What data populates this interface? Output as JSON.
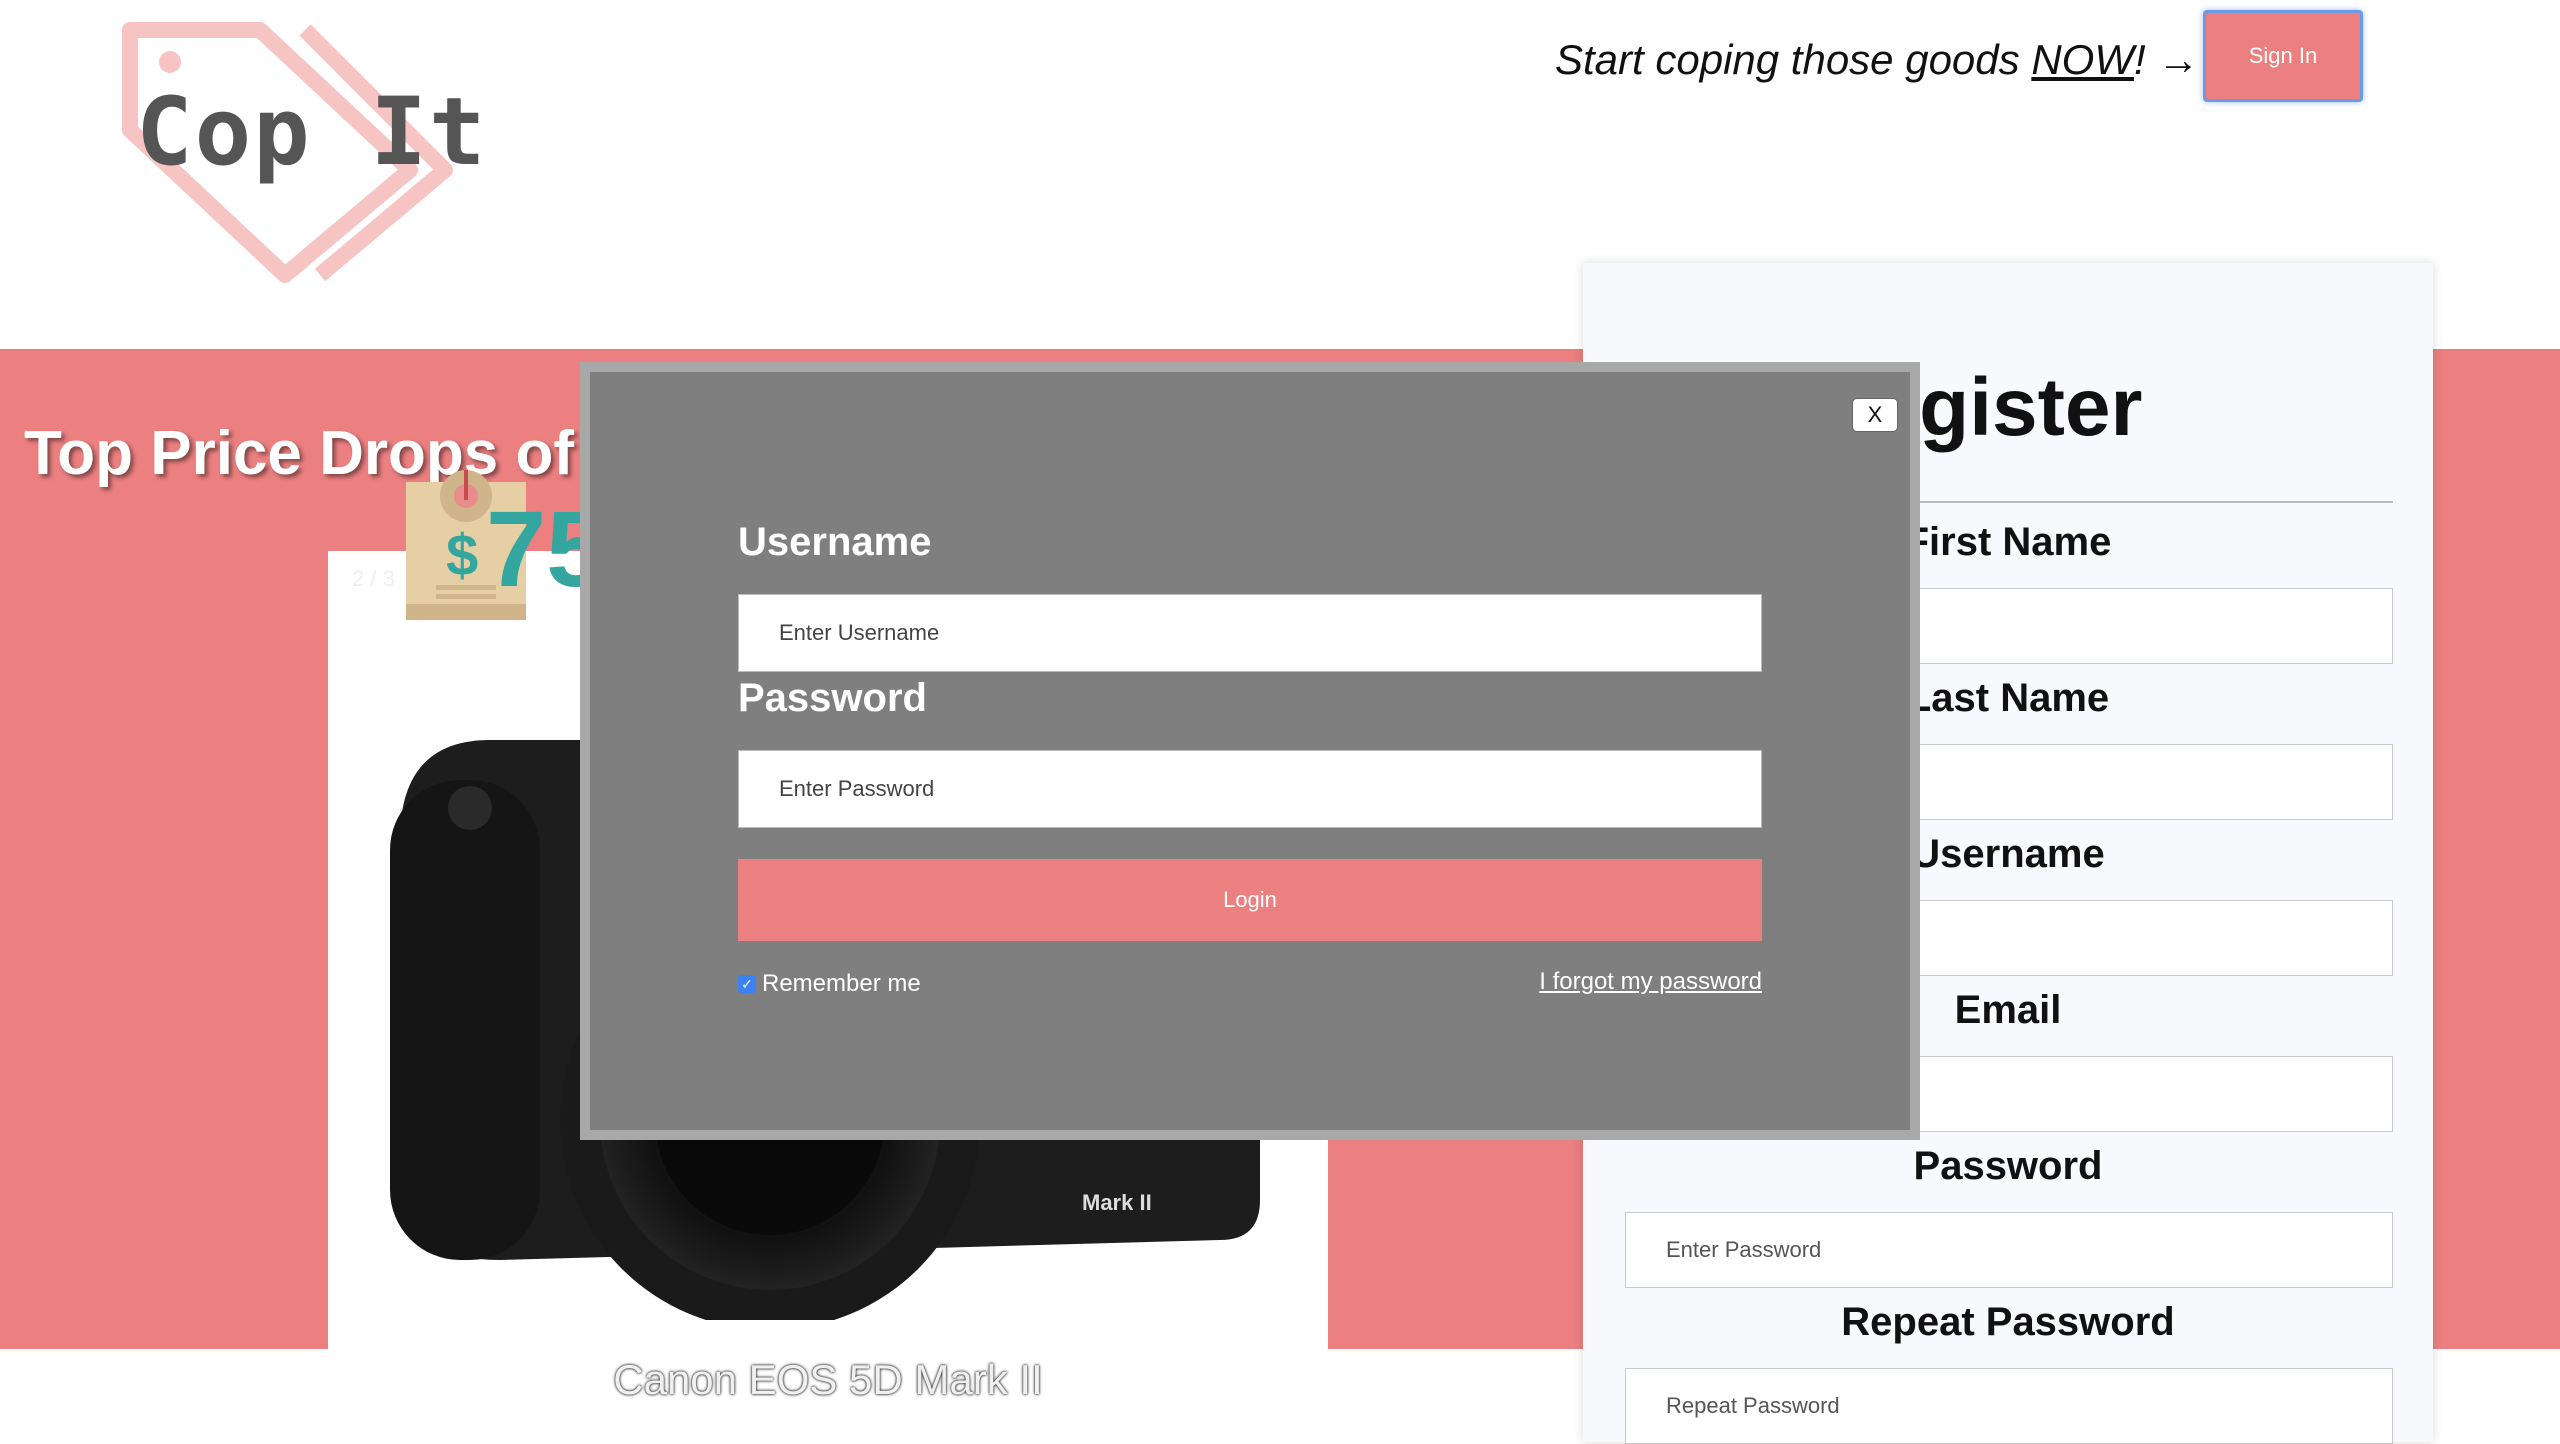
{
  "header": {
    "logo_text": "Cop It",
    "tagline_prefix": "Start coping those goods ",
    "tagline_now": "NOW",
    "tagline_suffix": "! →",
    "signin_label": "Sign In"
  },
  "showcase": {
    "title": "Top Price Drops of t",
    "slide_counter": "2 / 3",
    "price": "$75",
    "product_name": "Canon EOS 5D Mark II"
  },
  "register": {
    "title": "egister",
    "fields": [
      {
        "label": "First Name",
        "placeholder": ""
      },
      {
        "label": "Last Name",
        "placeholder": ""
      },
      {
        "label": "Username",
        "placeholder": ""
      },
      {
        "label": "Email",
        "placeholder": ""
      },
      {
        "label": "Password",
        "placeholder": "Enter Password"
      },
      {
        "label": "Repeat Password",
        "placeholder": "Repeat Password"
      }
    ]
  },
  "login_modal": {
    "close_label": "X",
    "username_label": "Username",
    "username_placeholder": "Enter Username",
    "password_label": "Password",
    "password_placeholder": "Enter Password",
    "login_label": "Login",
    "remember_label": "Remember me",
    "remember_checked": true,
    "forgot_label": "I forgot my password"
  },
  "colors": {
    "brand_pink": "#ec7f7f",
    "modal_gray": "#7f7f7f",
    "price_teal": "#33a6a0"
  }
}
